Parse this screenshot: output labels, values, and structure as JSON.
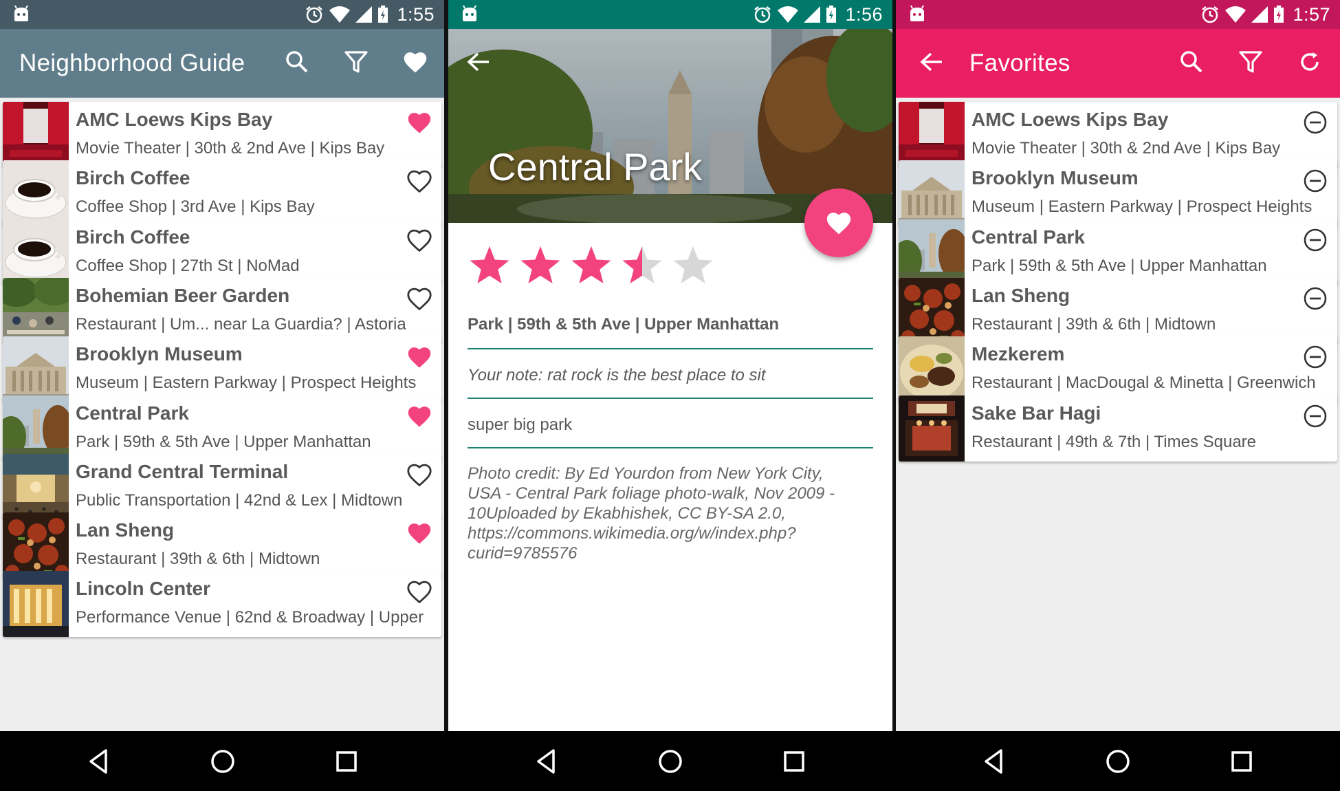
{
  "colors": {
    "guide_primary": "#607d8b",
    "guide_status": "#455a64",
    "detail_status": "#00796b",
    "favorites_primary": "#e91e63",
    "favorites_status": "#c2185b",
    "accent_pink": "#f3437f",
    "divider_teal": "#1e7f72"
  },
  "status_bars": [
    {
      "time": "1:55"
    },
    {
      "time": "1:56"
    },
    {
      "time": "1:57"
    }
  ],
  "guide": {
    "title": "Neighborhood Guide",
    "icons": [
      "search-icon",
      "filter-icon",
      "heart-icon"
    ],
    "items": [
      {
        "name": "AMC Loews Kips Bay",
        "sub": "Movie Theater | 30th & 2nd Ave | Kips Bay",
        "favorite": true,
        "thumb": "theater"
      },
      {
        "name": "Birch Coffee",
        "sub": "Coffee Shop | 3rd Ave | Kips Bay",
        "favorite": false,
        "thumb": "coffee"
      },
      {
        "name": "Birch Coffee",
        "sub": "Coffee Shop | 27th St | NoMad",
        "favorite": false,
        "thumb": "coffee"
      },
      {
        "name": "Bohemian Beer Garden",
        "sub": "Restaurant | Um... near La Guardia? | Astoria",
        "favorite": false,
        "thumb": "garden"
      },
      {
        "name": "Brooklyn Museum",
        "sub": "Museum | Eastern Parkway | Prospect Heights",
        "favorite": true,
        "thumb": "museum"
      },
      {
        "name": "Central Park",
        "sub": "Park | 59th & 5th Ave | Upper Manhattan",
        "favorite": true,
        "thumb": "park"
      },
      {
        "name": "Grand Central Terminal",
        "sub": "Public Transportation | 42nd & Lex | Midtown",
        "favorite": false,
        "thumb": "terminal"
      },
      {
        "name": "Lan Sheng",
        "sub": "Restaurant | 39th & 6th | Midtown",
        "favorite": true,
        "thumb": "food"
      },
      {
        "name": "Lincoln Center",
        "sub": "Performance Venue | 62nd & Broadway | Upper",
        "favorite": false,
        "thumb": "lincoln"
      }
    ]
  },
  "detail": {
    "title": "Central Park",
    "rating": 3.5,
    "rating_max": 5,
    "meta": "Park | 59th & 5th Ave | Upper Manhattan",
    "note": "Your note: rat rock is the best place to sit",
    "description": "super big park",
    "credit": "Photo credit: By Ed Yourdon from New York City, USA - Central Park foliage photo-walk, Nov 2009 - 10Uploaded by Ekabhishek, CC BY-SA 2.0, https://commons.wikimedia.org/w/index.php?curid=9785576"
  },
  "favorites": {
    "title": "Favorites",
    "icons": [
      "back-arrow-icon",
      "search-icon",
      "filter-icon",
      "refresh-icon"
    ],
    "items": [
      {
        "name": "AMC Loews Kips Bay",
        "sub": "Movie Theater | 30th & 2nd Ave | Kips Bay",
        "thumb": "theater"
      },
      {
        "name": "Brooklyn Museum",
        "sub": "Museum | Eastern Parkway | Prospect Heights",
        "thumb": "museum"
      },
      {
        "name": "Central Park",
        "sub": "Park | 59th & 5th Ave | Upper Manhattan",
        "thumb": "park"
      },
      {
        "name": "Lan Sheng",
        "sub": "Restaurant | 39th & 6th | Midtown",
        "thumb": "food"
      },
      {
        "name": "Mezkerem",
        "sub": "Restaurant | MacDougal & Minetta | Greenwich",
        "thumb": "ethiopian"
      },
      {
        "name": "Sake Bar Hagi",
        "sub": "Restaurant | 49th & 7th | Times Square",
        "thumb": "sakebar"
      }
    ]
  },
  "nav_icons": [
    "back-triangle-icon",
    "home-circle-icon",
    "recents-square-icon"
  ]
}
